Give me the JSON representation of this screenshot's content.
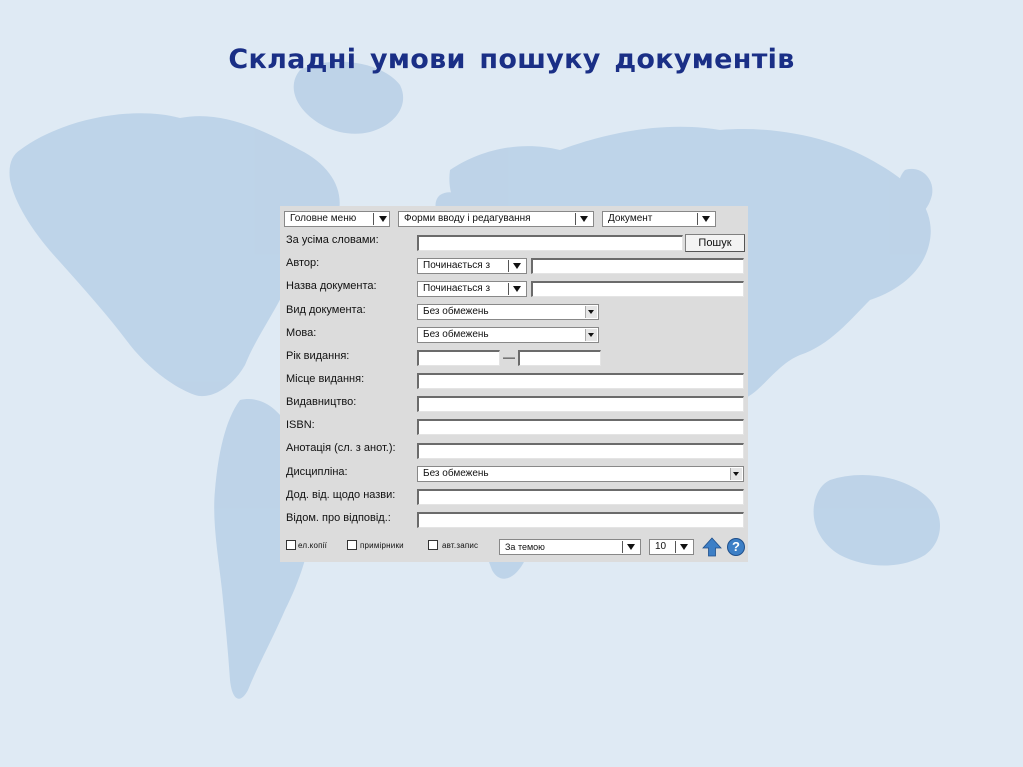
{
  "slide": {
    "title": "Складні умови пошуку документів"
  },
  "colors": {
    "title": "#1a2f86",
    "background": "#dfeaf4",
    "map": "#b7cfe6",
    "panel": "#dcdcdc",
    "icon_blue": "#3d7fc6"
  },
  "toolbar": {
    "main_menu": "Головне меню",
    "input_forms": "Форми вводу і редагування",
    "document": "Документ"
  },
  "fields": {
    "all_words_label": "За усіма словами:",
    "search_button": "Пошук",
    "author_label": "Автор:",
    "author_mode": "Починається з",
    "title_label": "Назва документа:",
    "title_mode": "Починається з",
    "doc_type_label": "Вид документа:",
    "doc_type_value": "Без обмежень",
    "language_label": "Мова:",
    "language_value": "Без обмежень",
    "year_label": "Рік видання:",
    "year_dash": "—",
    "place_label": "Місце видання:",
    "publisher_label": "Видавництво:",
    "isbn_label": "ISBN:",
    "annotation_label": "Анотація (сл. з анот.):",
    "discipline_label": "Дисципліна:",
    "discipline_value": "Без обмежень",
    "title_extra_label": "Дод. від. щодо назви:",
    "responsibility_label": "Відом. про відповід.:"
  },
  "footer": {
    "ecopies_label": "ел.копії",
    "examples_label": "примірники",
    "autorecord_label": "авт.запис",
    "sort_value": "За темою",
    "count_value": "10",
    "up_icon": "arrow-up-icon",
    "help_icon": "help-icon",
    "help_glyph": "?"
  }
}
